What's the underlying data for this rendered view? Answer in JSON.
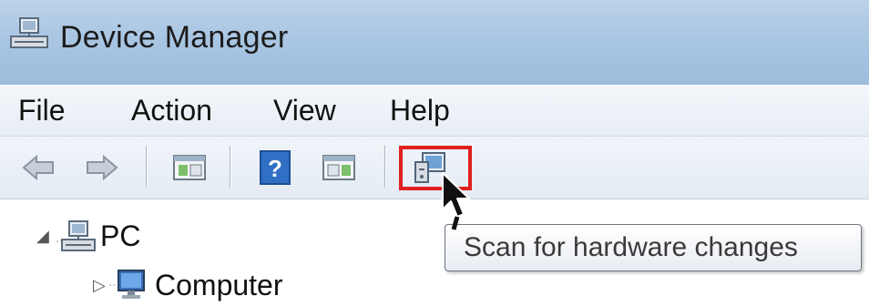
{
  "window": {
    "title": "Device Manager",
    "icon": "device-manager-icon"
  },
  "menu": {
    "items": [
      {
        "label": "File"
      },
      {
        "label": "Action"
      },
      {
        "label": "View"
      },
      {
        "label": "Help"
      }
    ]
  },
  "toolbar": {
    "buttons": [
      {
        "icon": "back-arrow-icon"
      },
      {
        "icon": "forward-arrow-icon"
      },
      {
        "icon": "show-hide-console-tree-icon"
      },
      {
        "icon": "help-icon"
      },
      {
        "icon": "show-hide-action-pane-icon"
      },
      {
        "icon": "scan-hardware-icon",
        "highlighted": true
      }
    ],
    "highlight_color": "#e02020"
  },
  "tooltip": {
    "text": "Scan for hardware changes"
  },
  "tree": {
    "root": {
      "label": "PC",
      "icon": "computer-network-icon",
      "expanded": true
    },
    "children": [
      {
        "label": "Computer",
        "icon": "monitor-icon",
        "expanded": false
      }
    ]
  }
}
